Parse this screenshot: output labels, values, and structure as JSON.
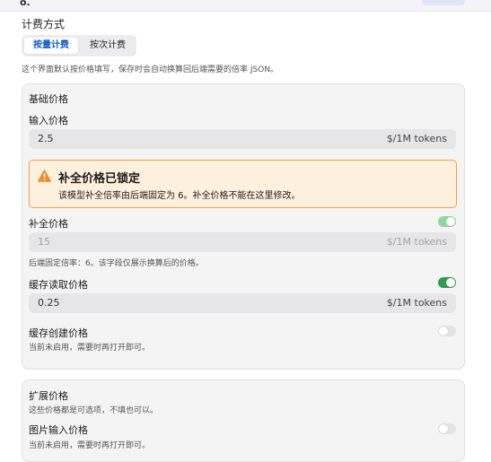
{
  "header": {
    "fragment": "o."
  },
  "pricing_mode": {
    "title": "计费方式",
    "tabs": [
      {
        "label": "按量计费",
        "active": true
      },
      {
        "label": "按次计费",
        "active": false
      }
    ],
    "description": "这个界面默认按价格填写，保存时会自动换算回后端需要的倍率 JSON。"
  },
  "base_price": {
    "title": "基础价格",
    "input_price": {
      "label": "输入价格",
      "value": "2.5",
      "unit": "$/1M tokens"
    },
    "warning": {
      "title": "补全价格已锁定",
      "text": "该模型补全倍率由后端固定为 6。补全价格不能在这里修改。"
    },
    "completion_price": {
      "label": "补全价格",
      "enabled": true,
      "value": "15",
      "unit": "$/1M tokens",
      "hint": "后端固定倍率：6。该字段仅展示换算后的价格。"
    },
    "cache_read_price": {
      "label": "缓存读取价格",
      "enabled": true,
      "value": "0.25",
      "unit": "$/1M tokens"
    },
    "cache_create_price": {
      "label": "缓存创建价格",
      "enabled": false,
      "hint": "当前未启用，需要时再打开即可。"
    }
  },
  "extended_price": {
    "title": "扩展价格",
    "hint": "这些价格都是可选项，不填也可以。",
    "image_input_price": {
      "label": "图片输入价格",
      "enabled": false,
      "hint": "当前未启用，需要时再打开即可。"
    }
  },
  "colors": {
    "accent": "#1457d1",
    "toggle_on": "#2f9e4a",
    "warning_border": "#f0a04e",
    "warning_bg": "#fdf0dc"
  }
}
